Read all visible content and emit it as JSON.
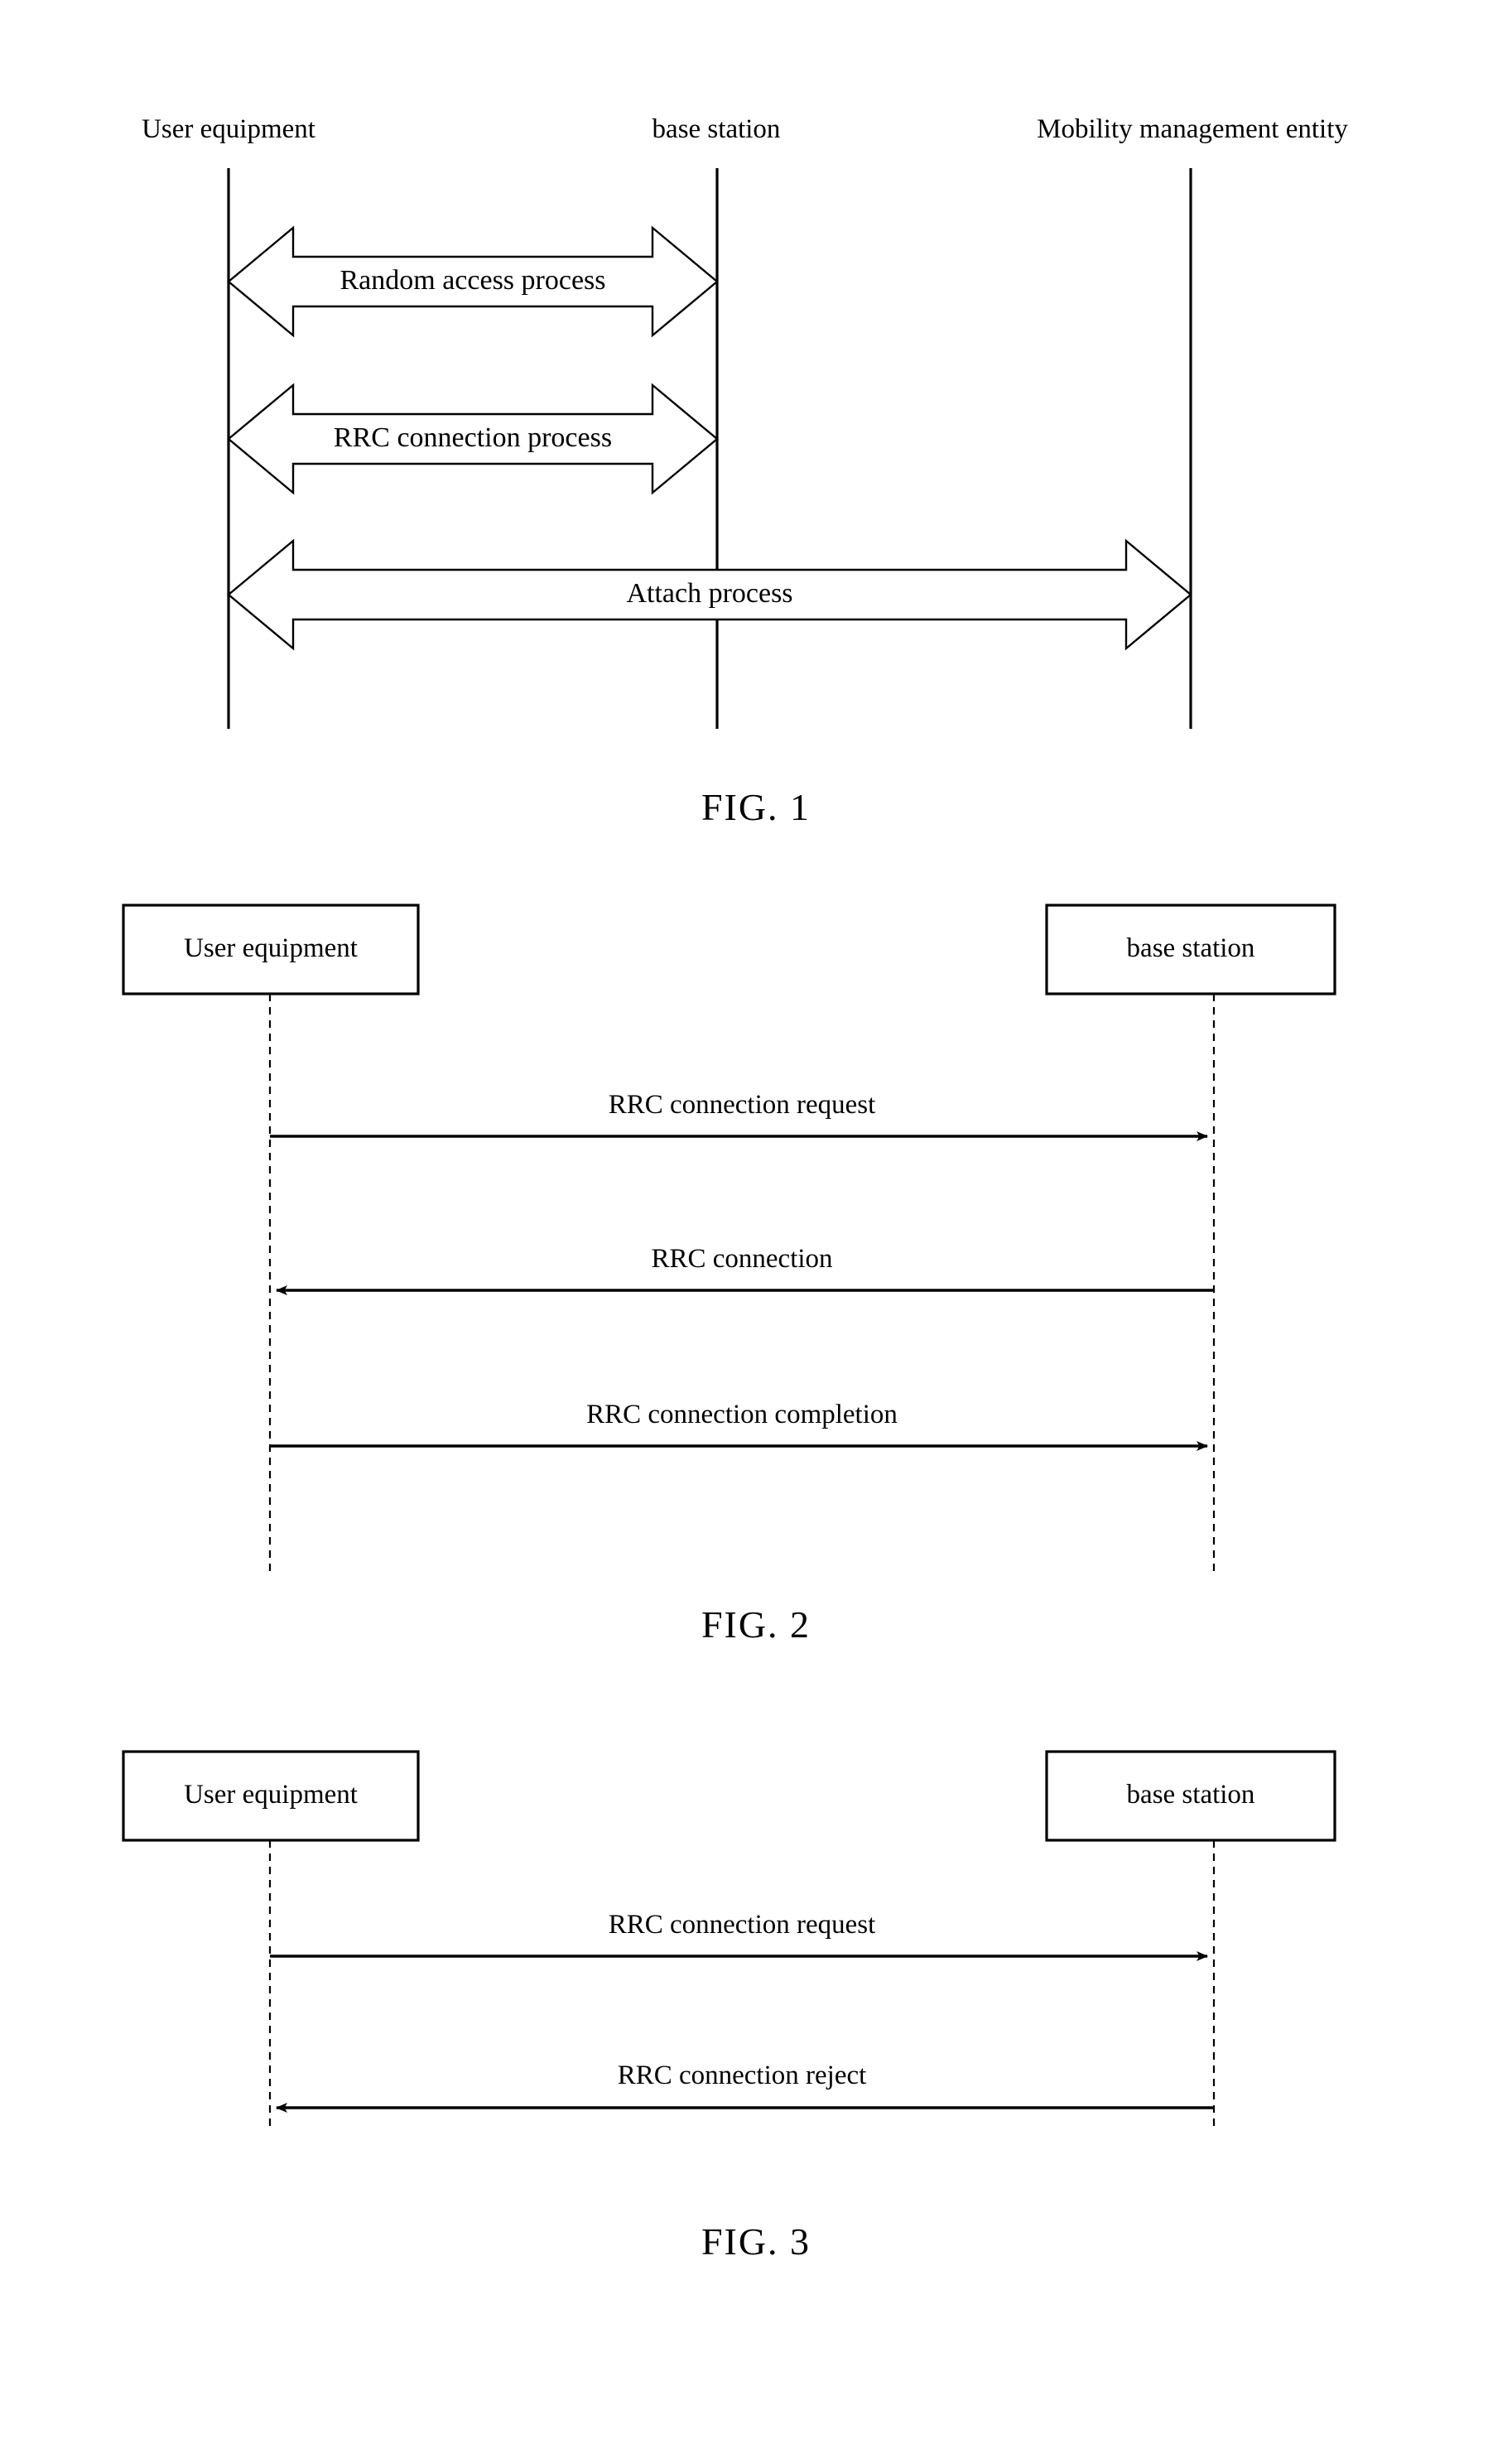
{
  "document": {
    "type": "patent-drawing-sheet",
    "background_color": "#ffffff",
    "ink_color": "#000000"
  },
  "figure1": {
    "caption": "FIG. 1",
    "actors": [
      {
        "id": "ue",
        "label": "User equipment"
      },
      {
        "id": "bs",
        "label": "base station"
      },
      {
        "id": "mme",
        "label": "Mobility management entity"
      }
    ],
    "messages": [
      {
        "label": "Random access process",
        "from": "ue",
        "to": "bs",
        "style": "double-block-arrow"
      },
      {
        "label": "RRC connection process",
        "from": "ue",
        "to": "bs",
        "style": "double-block-arrow"
      },
      {
        "label": "Attach process",
        "from": "ue",
        "to": "mme",
        "style": "double-block-arrow"
      }
    ]
  },
  "figure2": {
    "caption": "FIG. 2",
    "actors": [
      {
        "id": "ue",
        "label": "User equipment"
      },
      {
        "id": "bs",
        "label": "base station"
      }
    ],
    "messages": [
      {
        "label": "RRC connection request",
        "from": "ue",
        "to": "bs",
        "direction": "right"
      },
      {
        "label": "RRC connection",
        "from": "bs",
        "to": "ue",
        "direction": "left"
      },
      {
        "label": "RRC connection completion",
        "from": "ue",
        "to": "bs",
        "direction": "right"
      }
    ]
  },
  "figure3": {
    "caption": "FIG. 3",
    "actors": [
      {
        "id": "ue",
        "label": "User equipment"
      },
      {
        "id": "bs",
        "label": "base station"
      }
    ],
    "messages": [
      {
        "label": "RRC connection request",
        "from": "ue",
        "to": "bs",
        "direction": "right"
      },
      {
        "label": "RRC connection reject",
        "from": "bs",
        "to": "ue",
        "direction": "left"
      }
    ]
  }
}
